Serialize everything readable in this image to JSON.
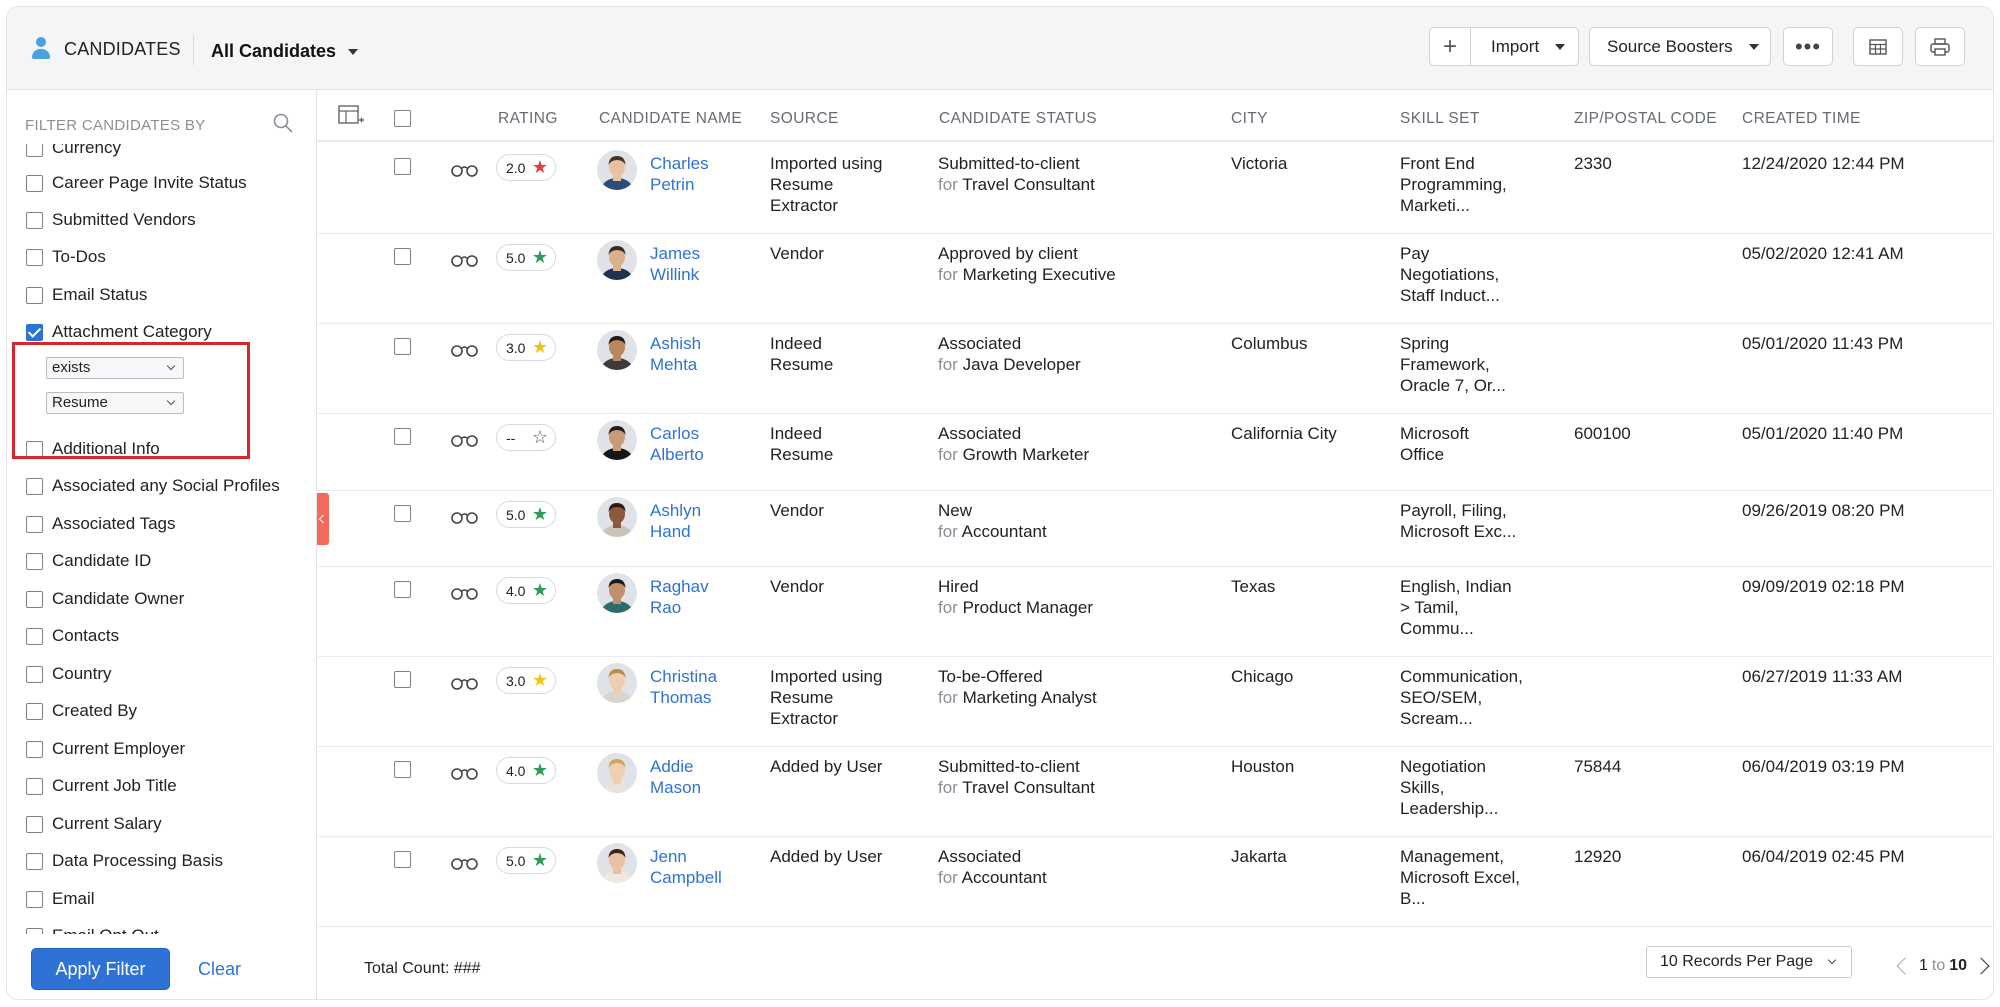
{
  "header": {
    "module_title": "CANDIDATES",
    "view": "All Candidates",
    "plus": "+",
    "import": "Import",
    "source_boosters": "Source Boosters",
    "more": "•••"
  },
  "sidebar": {
    "title": "FILTER CANDIDATES BY",
    "filters": [
      {
        "label": "Currency",
        "checked": false
      },
      {
        "label": "Career Page Invite Status",
        "checked": false
      },
      {
        "label": "Submitted Vendors",
        "checked": false
      },
      {
        "label": "To-Dos",
        "checked": false
      },
      {
        "label": "Email Status",
        "checked": false
      },
      {
        "label": "Attachment Category",
        "checked": true
      },
      {
        "label": "Additional Info",
        "checked": false
      },
      {
        "label": "Associated any Social Profiles",
        "checked": false
      },
      {
        "label": "Associated Tags",
        "checked": false
      },
      {
        "label": "Candidate ID",
        "checked": false
      },
      {
        "label": "Candidate Owner",
        "checked": false
      },
      {
        "label": "Contacts",
        "checked": false
      },
      {
        "label": "Country",
        "checked": false
      },
      {
        "label": "Created By",
        "checked": false
      },
      {
        "label": "Current Employer",
        "checked": false
      },
      {
        "label": "Current Job Title",
        "checked": false
      },
      {
        "label": "Current Salary",
        "checked": false
      },
      {
        "label": "Data Processing Basis",
        "checked": false
      },
      {
        "label": "Email",
        "checked": false
      },
      {
        "label": "Email Opt Out",
        "checked": false
      }
    ],
    "attachment_condition": "exists",
    "attachment_value": "Resume",
    "apply_label": "Apply Filter",
    "clear_label": "Clear"
  },
  "table": {
    "columns": [
      "RATING",
      "CANDIDATE NAME",
      "SOURCE",
      "CANDIDATE STATUS",
      "CITY",
      "SKILL SET",
      "ZIP/POSTAL CODE",
      "CREATED TIME"
    ],
    "for_label": "for",
    "rows": [
      {
        "rating": "2.0",
        "star_color": "#e23b3b",
        "name": [
          "Charles",
          "Petrin"
        ],
        "source": [
          "Imported using",
          "Resume",
          "Extractor"
        ],
        "status": "Submitted-to-client",
        "job": "Travel Consultant",
        "city": "Victoria",
        "skills": [
          "Front End",
          "Programming,",
          "Marketi..."
        ],
        "zip": "2330",
        "created": "12/24/2020 12:44 PM",
        "skin": "#e8c2a0",
        "hair": "#4a3322",
        "shirt": "#2c4d7a"
      },
      {
        "rating": "5.0",
        "star_color": "#2e9b57",
        "name": [
          "James",
          "Willink"
        ],
        "source": [
          "Vendor"
        ],
        "status": "Approved by client",
        "job": "Marketing Executive",
        "city": "",
        "skills": [
          "Pay",
          "Negotiations,",
          "Staff Induct..."
        ],
        "zip": "",
        "created": "05/02/2020 12:41 AM",
        "skin": "#d9b08c",
        "hair": "#3a2a1e",
        "shirt": "#1f3350"
      },
      {
        "rating": "3.0",
        "star_color": "#f2c21b",
        "name": [
          "Ashish",
          "Mehta"
        ],
        "source": [
          "Indeed",
          "Resume"
        ],
        "status": "Associated",
        "job": "Java Developer",
        "city": "Columbus",
        "skills": [
          "Spring",
          "Framework,",
          "Oracle 7, Or..."
        ],
        "zip": "",
        "created": "05/01/2020 11:43 PM",
        "skin": "#b98660",
        "hair": "#1d1a18",
        "shirt": "#3b3b3b"
      },
      {
        "rating": "--",
        "star_color": "#555555",
        "name": [
          "Carlos",
          "Alberto"
        ],
        "source": [
          "Indeed",
          "Resume"
        ],
        "status": "Associated",
        "job": "Growth Marketer",
        "city": "California City",
        "skills": [
          "Microsoft",
          "Office"
        ],
        "zip": "600100",
        "created": "05/01/2020 11:40 PM",
        "skin": "#c79a78",
        "hair": "#231a14",
        "shirt": "#161616"
      },
      {
        "rating": "5.0",
        "star_color": "#2e9b57",
        "name": [
          "Ashlyn",
          "Hand"
        ],
        "source": [
          "Vendor"
        ],
        "status": "New",
        "job": "Accountant",
        "city": "",
        "skills": [
          "Payroll, Filing,",
          "Microsoft Exc..."
        ],
        "zip": "",
        "created": "09/26/2019 08:20 PM",
        "skin": "#8a5a3c",
        "hair": "#2a1c14",
        "shirt": "#c9c3b8"
      },
      {
        "rating": "4.0",
        "star_color": "#2e9b57",
        "name": [
          "Raghav",
          "Rao"
        ],
        "source": [
          "Vendor"
        ],
        "status": "Hired",
        "job": "Product Manager",
        "city": "Texas",
        "skills": [
          "English, Indian",
          "> Tamil,",
          "Commu..."
        ],
        "zip": "",
        "created": "09/09/2019 02:18 PM",
        "skin": "#c08f6c",
        "hair": "#1c1c1c",
        "shirt": "#2e6b6b"
      },
      {
        "rating": "3.0",
        "star_color": "#f2c21b",
        "name": [
          "Christina",
          "Thomas"
        ],
        "source": [
          "Imported using",
          "Resume",
          "Extractor"
        ],
        "status": "To-be-Offered",
        "job": "Marketing Analyst",
        "city": "Chicago",
        "skills": [
          "Communication,",
          "SEO/SEM,",
          "Scream..."
        ],
        "zip": "",
        "created": "06/27/2019 11:33 AM",
        "skin": "#efcdb2",
        "hair": "#b98a52",
        "shirt": "#d9d4cc"
      },
      {
        "rating": "4.0",
        "star_color": "#2e9b57",
        "name": [
          "Addie",
          "Mason"
        ],
        "source": [
          "Added by User"
        ],
        "status": "Submitted-to-client",
        "job": "Travel Consultant",
        "city": "Houston",
        "skills": [
          "Negotiation",
          "Skills,",
          "Leadership..."
        ],
        "zip": "75844",
        "created": "06/04/2019 03:19 PM",
        "skin": "#f0cfb0",
        "hair": "#d4a45e",
        "shirt": "#e7e2da"
      },
      {
        "rating": "5.0",
        "star_color": "#2e9b57",
        "name": [
          "Jenn",
          "Campbell"
        ],
        "source": [
          "Added by User"
        ],
        "status": "Associated",
        "job": "Accountant",
        "city": "Jakarta",
        "skills": [
          "Management,",
          "Microsoft Excel,",
          "B..."
        ],
        "zip": "12920",
        "created": "06/04/2019 02:45 PM",
        "skin": "#e9c1a0",
        "hair": "#3b2418",
        "shirt": "#efe9e1"
      }
    ]
  },
  "footer": {
    "total": "Total Count: ###",
    "per_page": "10 Records Per Page",
    "page_from": "1",
    "page_to_word": "to",
    "page_to": "10"
  }
}
